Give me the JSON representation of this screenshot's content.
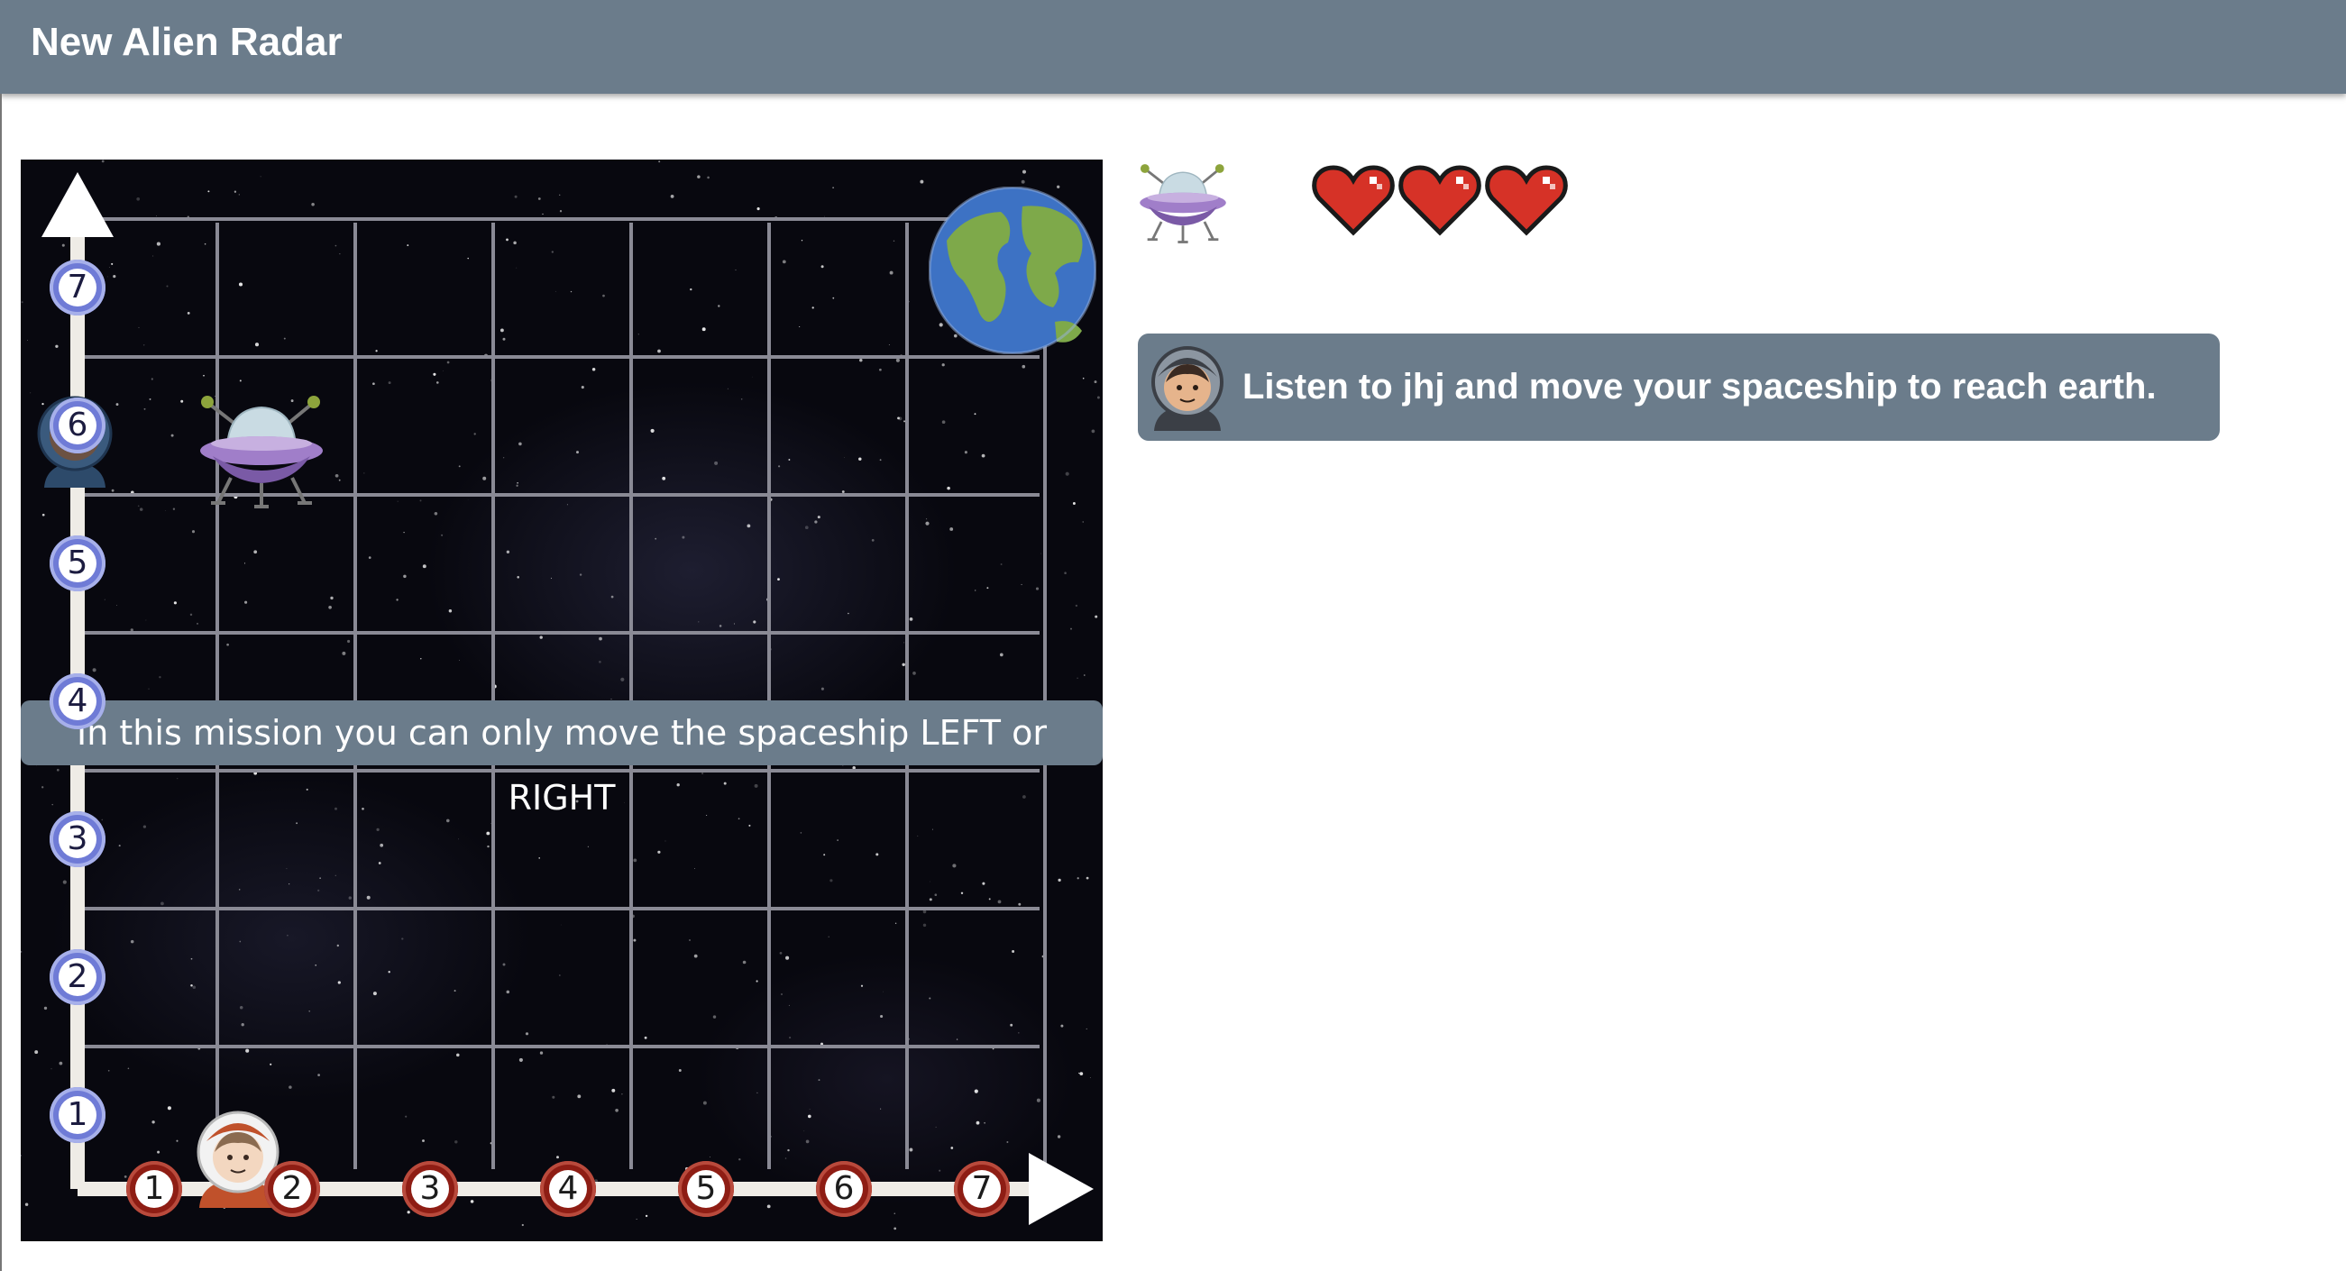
{
  "app": {
    "title": "New Alien Radar"
  },
  "board": {
    "y_axis_labels": [
      "1",
      "2",
      "3",
      "4",
      "5",
      "6",
      "7"
    ],
    "x_axis_labels": [
      "1",
      "2",
      "3",
      "4",
      "5",
      "6",
      "7"
    ],
    "spaceship": {
      "x": 1.3,
      "y": 6.3
    },
    "earth": {
      "x": 7,
      "y": 7
    },
    "banner": "In this mission you can only move the spaceship LEFT or RIGHT"
  },
  "status": {
    "lives": 3,
    "message": "Listen to jhj and move your spaceship to reach earth."
  },
  "colors": {
    "header": "#6b7c8b",
    "y_badge": "#6f7bd6",
    "x_badge": "#8e1d14",
    "heart": "#d63227",
    "grid": "#8a8a95"
  },
  "icons": {
    "spaceship": "ufo-icon",
    "goal": "earth-icon",
    "lives": "heart-icon",
    "guide": "astronaut-icon"
  }
}
